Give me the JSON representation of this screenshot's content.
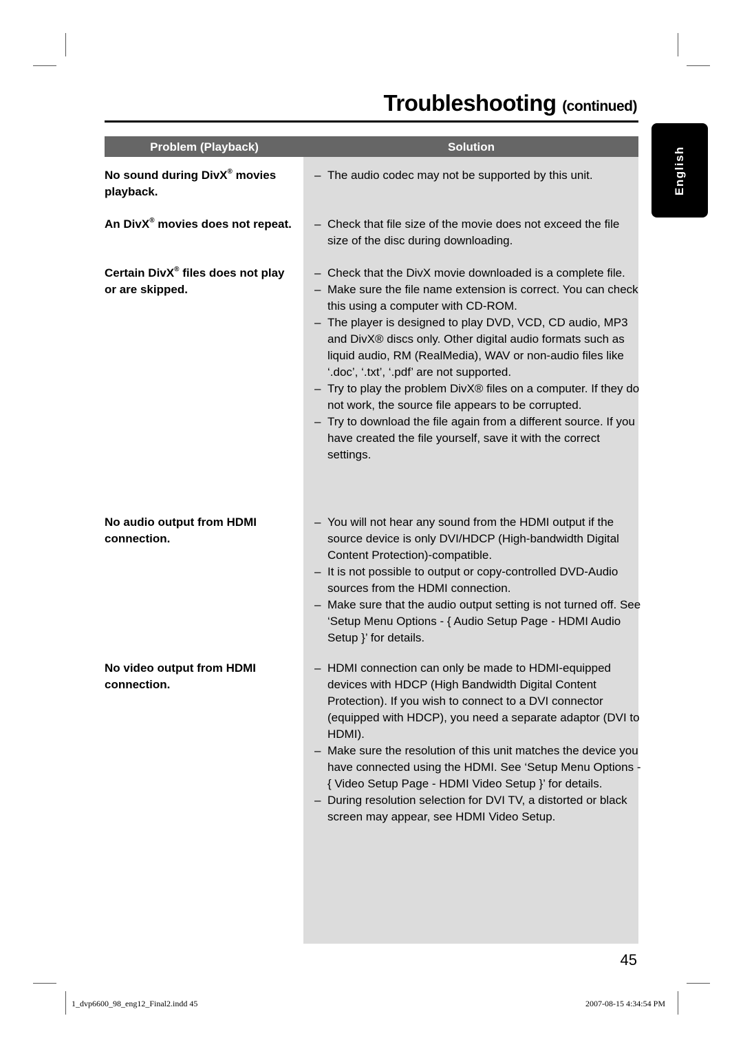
{
  "header": {
    "title": "Troubleshooting",
    "title_suffix": "(continued)"
  },
  "language_tab": "English",
  "table": {
    "col_problem": "Problem (Playback)",
    "col_solution": "Solution",
    "rows": [
      {
        "problem": [
          "No sound during DivX",
          "®",
          " movies playback."
        ],
        "solutions": [
          "The audio codec may not be supported by this unit."
        ]
      },
      {
        "problem": [
          "An DivX",
          "®",
          " movies does not repeat."
        ],
        "solutions": [
          "Check that file size of the movie does not exceed the file size of the disc during downloading."
        ]
      },
      {
        "problem": [
          "Certain DivX",
          "®",
          " files does not play or are skipped."
        ],
        "solutions": [
          "Check that the DivX movie downloaded is a complete file.",
          "Make sure the file name extension is correct. You can check this using a computer with CD-ROM.",
          "The player is designed to play DVD, VCD, CD audio, MP3 and DivX® discs only. Other digital audio formats such as liquid audio, RM (RealMedia), WAV or non-audio files like ‘.doc’, ‘.txt’, ‘.pdf’ are not supported.",
          "Try to play the problem DivX® files on a computer. If they do not work, the source file appears to be corrupted.",
          "Try to download the file again from a different source. If you have created the file yourself, save it with the correct settings."
        ]
      },
      {
        "problem": [
          "No audio output from HDMI connection.",
          "",
          ""
        ],
        "solutions": [
          "You will not hear any sound from the HDMI output if the source device is only DVI/HDCP (High-bandwidth Digital Content Protection)-compatible.",
          "It is not possible to output or copy-controlled DVD-Audio sources from the HDMI connection.",
          "Make sure that the audio output setting is not turned off. See ‘Setup Menu Options - { Audio Setup Page - HDMI Audio Setup }’ for details."
        ]
      },
      {
        "problem": [
          "No video output from HDMI connection.",
          "",
          ""
        ],
        "solutions": [
          "HDMI connection can only be made to HDMI-equipped devices with HDCP (High Bandwidth Digital Content Protection). If you wish to connect to a DVI connector (equipped with HDCP), you need a separate adaptor (DVI to HDMI).",
          "Make sure the resolution of this unit matches the device you have connected using the HDMI. See ‘Setup Menu Options - { Video Setup Page - HDMI Video Setup }’ for details.",
          "During resolution selection for DVI TV, a distorted or black screen may appear, see HDMI Video Setup."
        ]
      }
    ]
  },
  "page_number": "45",
  "footer": {
    "file": "1_dvp6600_98_eng12_Final2.indd   45",
    "date": "2007-08-15   4:34:54 PM"
  },
  "dash": "–"
}
